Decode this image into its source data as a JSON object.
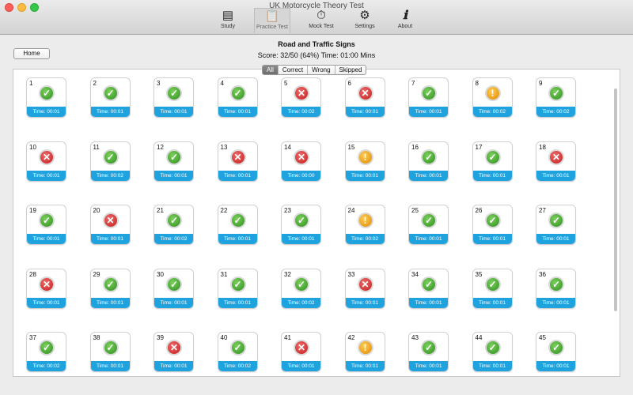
{
  "window": {
    "title": "UK Motorcycle Theory Test"
  },
  "toolbar": [
    {
      "label": "Study",
      "icon": "book-icon",
      "glyph": "▤"
    },
    {
      "label": "Practice Test",
      "icon": "clipboard-icon",
      "glyph": "📋"
    },
    {
      "label": "Mock Test",
      "icon": "stopwatch-icon",
      "glyph": "⏱"
    },
    {
      "label": "Settings",
      "icon": "gear-icon",
      "glyph": "⚙"
    },
    {
      "label": "About",
      "icon": "info-icon",
      "glyph": "ℹ"
    }
  ],
  "header": {
    "home_label": "Home",
    "title": "Road and Traffic Signs",
    "score": "Score: 32/50 (64%) Time: 01:00 Mins"
  },
  "filters": [
    "All",
    "Correct",
    "Wrong",
    "Skipped"
  ],
  "colors": {
    "correct": "#3aa52a",
    "wrong": "#d62b2b",
    "skipped": "#f0a81e",
    "time_bar": "#1fa3df"
  },
  "questions": [
    {
      "num": "1",
      "status": "correct",
      "time": "Time: 00:01"
    },
    {
      "num": "2",
      "status": "correct",
      "time": "Time: 00:01"
    },
    {
      "num": "3",
      "status": "correct",
      "time": "Time: 00:01"
    },
    {
      "num": "4",
      "status": "correct",
      "time": "Time: 00:01"
    },
    {
      "num": "5",
      "status": "wrong",
      "time": "Time: 00:02"
    },
    {
      "num": "6",
      "status": "wrong",
      "time": "Time: 00:01"
    },
    {
      "num": "7",
      "status": "correct",
      "time": "Time: 00:01"
    },
    {
      "num": "8",
      "status": "skipped",
      "time": "Time: 00:02"
    },
    {
      "num": "9",
      "status": "correct",
      "time": "Time: 00:02"
    },
    {
      "num": "10",
      "status": "wrong",
      "time": "Time: 00:01"
    },
    {
      "num": "11",
      "status": "correct",
      "time": "Time: 00:02"
    },
    {
      "num": "12",
      "status": "correct",
      "time": "Time: 00:01"
    },
    {
      "num": "13",
      "status": "wrong",
      "time": "Time: 00:01"
    },
    {
      "num": "14",
      "status": "wrong",
      "time": "Time: 00:00"
    },
    {
      "num": "15",
      "status": "skipped",
      "time": "Time: 00:01"
    },
    {
      "num": "16",
      "status": "correct",
      "time": "Time: 00:01"
    },
    {
      "num": "17",
      "status": "correct",
      "time": "Time: 00:01"
    },
    {
      "num": "18",
      "status": "wrong",
      "time": "Time: 00:01"
    },
    {
      "num": "19",
      "status": "correct",
      "time": "Time: 00:01"
    },
    {
      "num": "20",
      "status": "wrong",
      "time": "Time: 00:01"
    },
    {
      "num": "21",
      "status": "correct",
      "time": "Time: 00:02"
    },
    {
      "num": "22",
      "status": "correct",
      "time": "Time: 00:01"
    },
    {
      "num": "23",
      "status": "correct",
      "time": "Time: 00:01"
    },
    {
      "num": "24",
      "status": "skipped",
      "time": "Time: 00:02"
    },
    {
      "num": "25",
      "status": "correct",
      "time": "Time: 00:01"
    },
    {
      "num": "26",
      "status": "correct",
      "time": "Time: 00:01"
    },
    {
      "num": "27",
      "status": "correct",
      "time": "Time: 00:01"
    },
    {
      "num": "28",
      "status": "wrong",
      "time": "Time: 00:01"
    },
    {
      "num": "29",
      "status": "correct",
      "time": "Time: 00:01"
    },
    {
      "num": "30",
      "status": "correct",
      "time": "Time: 00:01"
    },
    {
      "num": "31",
      "status": "correct",
      "time": "Time: 00:01"
    },
    {
      "num": "32",
      "status": "correct",
      "time": "Time: 00:02"
    },
    {
      "num": "33",
      "status": "wrong",
      "time": "Time: 00:01"
    },
    {
      "num": "34",
      "status": "correct",
      "time": "Time: 00:01"
    },
    {
      "num": "35",
      "status": "correct",
      "time": "Time: 00:01"
    },
    {
      "num": "36",
      "status": "correct",
      "time": "Time: 00:01"
    },
    {
      "num": "37",
      "status": "correct",
      "time": "Time: 00:02"
    },
    {
      "num": "38",
      "status": "correct",
      "time": "Time: 00:01"
    },
    {
      "num": "39",
      "status": "wrong",
      "time": "Time: 00:01"
    },
    {
      "num": "40",
      "status": "correct",
      "time": "Time: 00:02"
    },
    {
      "num": "41",
      "status": "wrong",
      "time": "Time: 00:01"
    },
    {
      "num": "42",
      "status": "skipped",
      "time": "Time: 00:01"
    },
    {
      "num": "43",
      "status": "correct",
      "time": "Time: 00:01"
    },
    {
      "num": "44",
      "status": "correct",
      "time": "Time: 00:01"
    },
    {
      "num": "45",
      "status": "correct",
      "time": "Time: 00:01"
    }
  ]
}
